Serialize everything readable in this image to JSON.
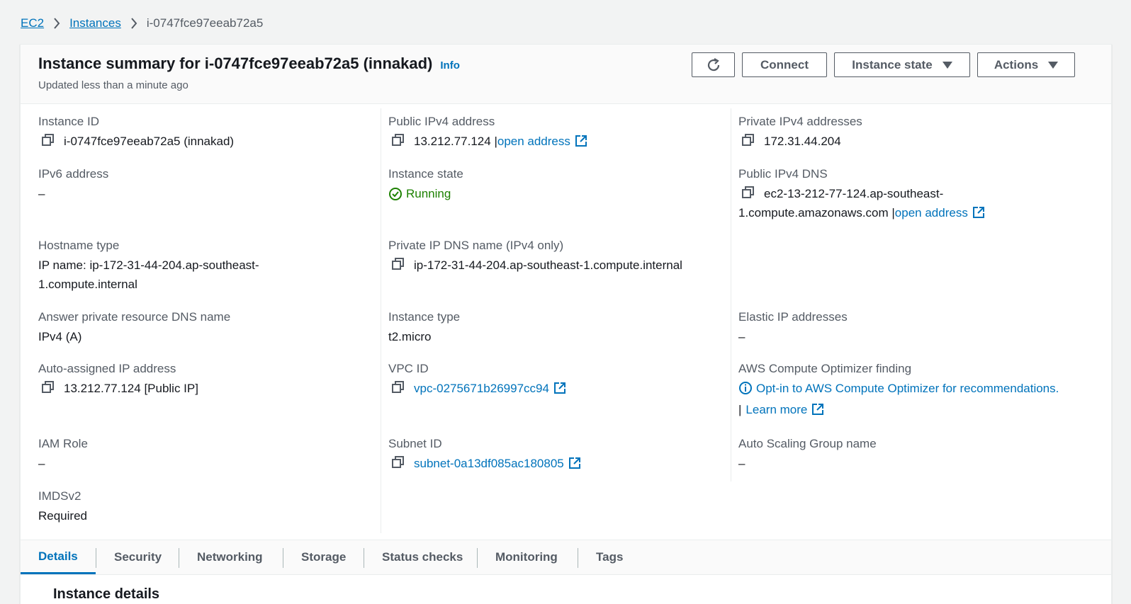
{
  "breadcrumb": {
    "items": [
      "EC2",
      "Instances"
    ],
    "current": "i-0747fce97eeab72a5"
  },
  "header": {
    "title": "Instance summary for i-0747fce97eeab72a5 (innakad)",
    "info": "Info",
    "subtitle": "Updated less than a minute ago",
    "buttons": {
      "connect": "Connect",
      "instance_state": "Instance state",
      "actions": "Actions"
    }
  },
  "details": {
    "instance_id": {
      "label": "Instance ID",
      "value": "i-0747fce97eeab72a5 (innakad)"
    },
    "ipv6": {
      "label": "IPv6 address",
      "value": "–"
    },
    "hostname_type": {
      "label": "Hostname type",
      "value_line1": "IP name: ip-172-31-44-204.ap-southeast-",
      "value_line2": "1.compute.internal"
    },
    "answer_dns": {
      "label": "Answer private resource DNS name",
      "value": "IPv4 (A)"
    },
    "auto_ip": {
      "label": "Auto-assigned IP address",
      "value": "13.212.77.124 [Public IP]"
    },
    "iam_role": {
      "label": "IAM Role",
      "value": "–"
    },
    "imdsv2": {
      "label": "IMDSv2",
      "value": "Required"
    },
    "public_ipv4": {
      "label": "Public IPv4 address",
      "value": "13.212.77.124 |",
      "link": "open address"
    },
    "instance_state": {
      "label": "Instance state",
      "value": "Running"
    },
    "private_dns": {
      "label": "Private IP DNS name (IPv4 only)",
      "value": "ip-172-31-44-204.ap-southeast-1.compute.internal"
    },
    "instance_type": {
      "label": "Instance type",
      "value": "t2.micro"
    },
    "vpc_id": {
      "label": "VPC ID",
      "value": "vpc-0275671b26997cc94"
    },
    "subnet_id": {
      "label": "Subnet ID",
      "value": "subnet-0a13df085ac180805"
    },
    "private_ipv4": {
      "label": "Private IPv4 addresses",
      "value": "172.31.44.204"
    },
    "public_dns": {
      "label": "Public IPv4 DNS",
      "value_line1": "ec2-13-212-77-124.ap-southeast-",
      "value_line2": "1.compute.amazonaws.com |",
      "link": "open address"
    },
    "elastic_ip": {
      "label": "Elastic IP addresses",
      "value": "–"
    },
    "optimizer": {
      "label": "AWS Compute Optimizer finding",
      "link": "Opt-in to AWS Compute Optimizer for recommendations.",
      "sep": "|",
      "learn_more": "Learn more"
    },
    "asg": {
      "label": "Auto Scaling Group name",
      "value": "–"
    }
  },
  "tabs": [
    "Details",
    "Security",
    "Networking",
    "Storage",
    "Status checks",
    "Monitoring",
    "Tags"
  ],
  "below": {
    "heading": "Instance details"
  },
  "colors": {
    "link": "#0073bb",
    "success": "#1d8102",
    "text": "#16191f",
    "muted": "#545b64"
  }
}
